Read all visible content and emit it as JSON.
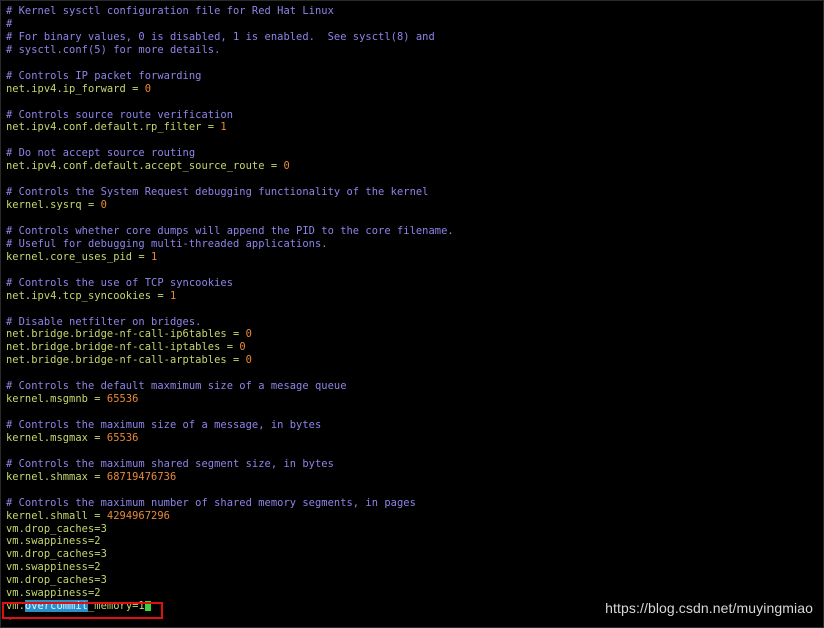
{
  "editor": {
    "lines": [
      {
        "type": "comment",
        "text": "# Kernel sysctl configuration file for Red Hat Linux"
      },
      {
        "type": "comment",
        "text": "#"
      },
      {
        "type": "comment",
        "text": "# For binary values, 0 is disabled, 1 is enabled.  See sysctl(8) and"
      },
      {
        "type": "comment",
        "text": "# sysctl.conf(5) for more details."
      },
      {
        "type": "blank",
        "text": ""
      },
      {
        "type": "comment",
        "text": "# Controls IP packet forwarding"
      },
      {
        "type": "setting",
        "key": "net.ipv4.ip_forward = ",
        "value": "0"
      },
      {
        "type": "blank",
        "text": ""
      },
      {
        "type": "comment",
        "text": "# Controls source route verification"
      },
      {
        "type": "setting",
        "key": "net.ipv4.conf.default.rp_filter = ",
        "value": "1"
      },
      {
        "type": "blank",
        "text": ""
      },
      {
        "type": "comment",
        "text": "# Do not accept source routing"
      },
      {
        "type": "setting",
        "key": "net.ipv4.conf.default.accept_source_route = ",
        "value": "0"
      },
      {
        "type": "blank",
        "text": ""
      },
      {
        "type": "comment",
        "text": "# Controls the System Request debugging functionality of the kernel"
      },
      {
        "type": "setting",
        "key": "kernel.sysrq = ",
        "value": "0"
      },
      {
        "type": "blank",
        "text": ""
      },
      {
        "type": "comment",
        "text": "# Controls whether core dumps will append the PID to the core filename."
      },
      {
        "type": "comment",
        "text": "# Useful for debugging multi-threaded applications."
      },
      {
        "type": "setting",
        "key": "kernel.core_uses_pid = ",
        "value": "1"
      },
      {
        "type": "blank",
        "text": ""
      },
      {
        "type": "comment",
        "text": "# Controls the use of TCP syncookies"
      },
      {
        "type": "setting",
        "key": "net.ipv4.tcp_syncookies = ",
        "value": "1"
      },
      {
        "type": "blank",
        "text": ""
      },
      {
        "type": "comment",
        "text": "# Disable netfilter on bridges."
      },
      {
        "type": "setting",
        "key": "net.bridge.bridge-nf-call-ip6tables = ",
        "value": "0"
      },
      {
        "type": "setting",
        "key": "net.bridge.bridge-nf-call-iptables = ",
        "value": "0"
      },
      {
        "type": "setting",
        "key": "net.bridge.bridge-nf-call-arptables = ",
        "value": "0"
      },
      {
        "type": "blank",
        "text": ""
      },
      {
        "type": "comment",
        "text": "# Controls the default maxmimum size of a mesage queue"
      },
      {
        "type": "setting",
        "key": "kernel.msgmnb = ",
        "value": "65536"
      },
      {
        "type": "blank",
        "text": ""
      },
      {
        "type": "comment",
        "text": "# Controls the maximum size of a message, in bytes"
      },
      {
        "type": "setting",
        "key": "kernel.msgmax = ",
        "value": "65536"
      },
      {
        "type": "blank",
        "text": ""
      },
      {
        "type": "comment",
        "text": "# Controls the maximum shared segment size, in bytes"
      },
      {
        "type": "setting",
        "key": "kernel.shmmax = ",
        "value": "68719476736"
      },
      {
        "type": "blank",
        "text": ""
      },
      {
        "type": "comment",
        "text": "# Controls the maximum number of shared memory segments, in pages"
      },
      {
        "type": "setting",
        "key": "kernel.shmall = ",
        "value": "4294967296"
      },
      {
        "type": "plain",
        "text": "vm.drop_caches=3"
      },
      {
        "type": "plain",
        "text": "vm.swappiness=2"
      },
      {
        "type": "plain",
        "text": "vm.drop_caches=3"
      },
      {
        "type": "plain",
        "text": "vm.swappiness=2"
      },
      {
        "type": "plain",
        "text": "vm.drop_caches=3"
      },
      {
        "type": "plain",
        "text": "vm.swappiness=2"
      }
    ],
    "cursor_line": {
      "prefix": "vm.",
      "highlight": "overcommit",
      "rest": "_memory=1"
    },
    "tilde": "~"
  },
  "watermark": "https://blog.csdn.net/muyingmiao",
  "colors": {
    "background": "#000000",
    "comment": "#8d84e8",
    "setting": "#c6d66e",
    "value": "#e88a3a",
    "highlight": "#2a8fc8",
    "cursor": "#3bd43b",
    "annotation_box": "#e01010"
  }
}
